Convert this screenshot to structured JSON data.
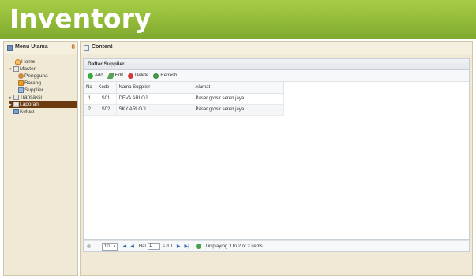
{
  "app": {
    "title": "Inventory"
  },
  "left_panel": {
    "title": "Menu Utama",
    "collapse_glyph": "0",
    "tree": [
      {
        "label": "Home",
        "icon": "home-icon"
      },
      {
        "label": "Master",
        "icon": "folder-icon",
        "expander": "▾"
      },
      {
        "label": "Pengguna",
        "icon": "user-icon"
      },
      {
        "label": "Barang",
        "icon": "box-icon"
      },
      {
        "label": "Supplier",
        "icon": "supplier-icon"
      },
      {
        "label": "Transaksi",
        "icon": "folder-icon",
        "expander": "▸"
      },
      {
        "label": "Laporan",
        "icon": "folder-icon",
        "expander": "▸",
        "selected": true
      },
      {
        "label": "Keluar",
        "icon": "exit-icon"
      }
    ]
  },
  "content_panel": {
    "tab_title": "Content"
  },
  "grid": {
    "title": "Daftar Supplier",
    "toolbar": {
      "add": "Add",
      "edit": "Edit",
      "delete": "Delete",
      "refresh": "Refresh"
    },
    "columns": {
      "no": "No",
      "kode": "Kode",
      "nama": "Nama Supplier",
      "alamat": "Alamat"
    },
    "rows": [
      {
        "no": "1",
        "kode": "S01",
        "nama": "DEVA ARLOJI",
        "alamat": "Pasar grosir seren jaya"
      },
      {
        "no": "2",
        "kode": "S02",
        "nama": "SKY ARLOJI",
        "alamat": "Pasar grosir seren jaya"
      }
    ]
  },
  "pager": {
    "page_size": "10",
    "first": "|◀",
    "prev": "◀",
    "hal_label": "Hal",
    "page_value": "1",
    "of_label": "s.d 1",
    "next": "▶",
    "last": "▶|",
    "status": "Displaying 1 to 2 of 2 items"
  },
  "colors": {
    "header": "#8fb838",
    "panel": "#efe9d6",
    "selected": "#6b3a10"
  }
}
